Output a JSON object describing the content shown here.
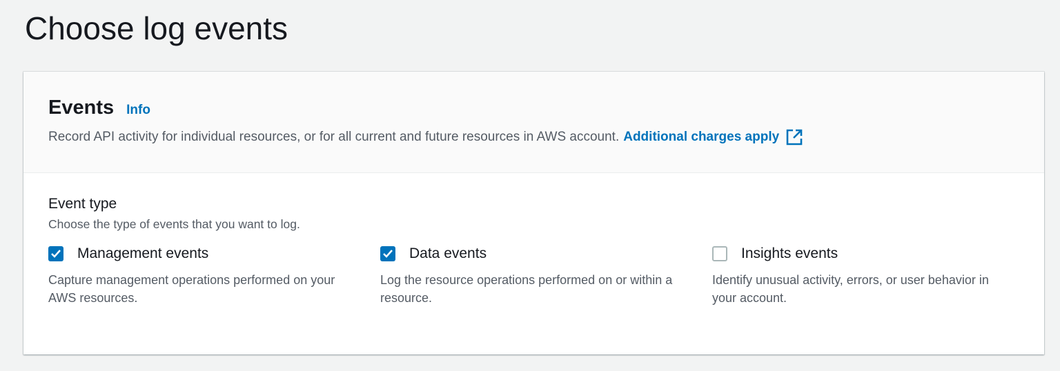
{
  "page_title": "Choose log events",
  "card": {
    "title": "Events",
    "info_label": "Info",
    "description": "Record API activity for individual resources, or for all current and future resources in AWS account.",
    "charges_link": "Additional charges apply",
    "event_type": {
      "label": "Event type",
      "description": "Choose the type of events that you want to log.",
      "options": [
        {
          "label": "Management events",
          "checked": true,
          "description": "Capture management operations performed on your AWS resources."
        },
        {
          "label": "Data events",
          "checked": true,
          "description": "Log the resource operations performed on or within a resource."
        },
        {
          "label": "Insights events",
          "checked": false,
          "description": "Identify unusual activity, errors, or user behavior in your account."
        }
      ]
    }
  },
  "colors": {
    "accent": "#0073bb",
    "background": "#f2f3f3"
  }
}
